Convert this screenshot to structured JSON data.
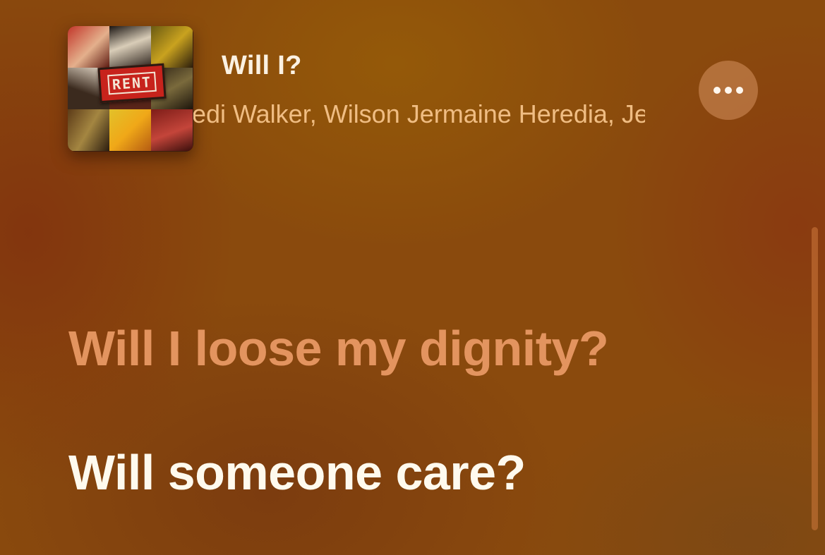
{
  "now_playing": {
    "title": "Will I?",
    "artists": "Fredi Walker, Wilson Jermaine Heredia, Jesse L. Martin,",
    "artwork_text": "RENT"
  },
  "more_button": {
    "icon": "ellipsis-icon"
  },
  "lyrics": {
    "previous_line": "Will I loose my dignity?",
    "current_line": "Will someone care?"
  },
  "colors": {
    "background": "#8a4a0d",
    "previous_line": "#e3945f",
    "current_line": "#fffaee",
    "artist_text": "#f0bd83"
  }
}
